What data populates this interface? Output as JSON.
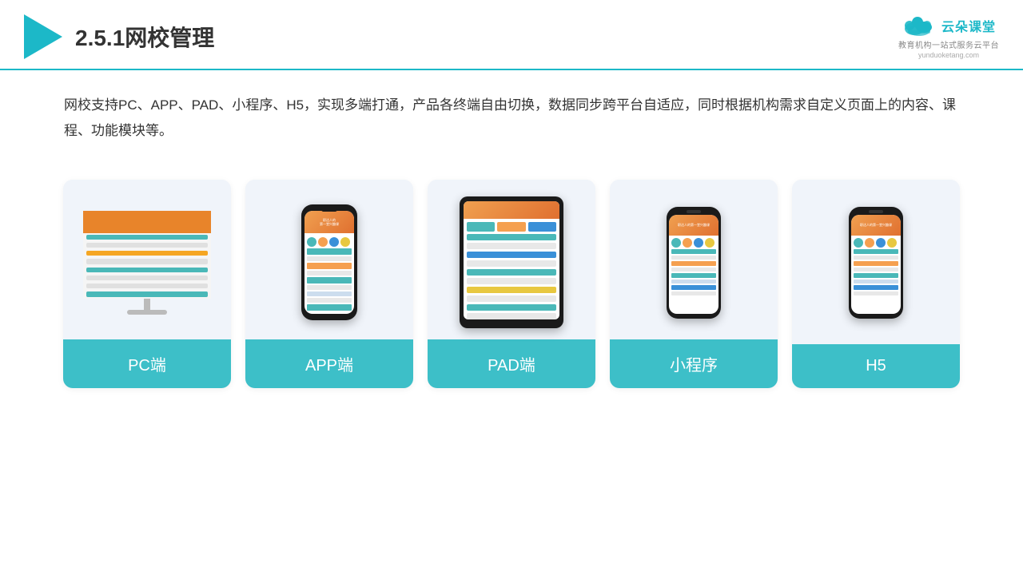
{
  "header": {
    "title": "2.5.1网校管理",
    "logo_name": "云朵课堂",
    "logo_url": "yunduoketang.com",
    "logo_tagline": "教育机构一站式服务云平台"
  },
  "description": "网校支持PC、APP、PAD、小程序、H5，实现多端打通，产品各终端自由切换，数据同步跨平台自适应，同时根据机构需求自定义页面上的内容、课程、功能模块等。",
  "cards": [
    {
      "id": "pc",
      "label": "PC端"
    },
    {
      "id": "app",
      "label": "APP端"
    },
    {
      "id": "pad",
      "label": "PAD端"
    },
    {
      "id": "miniprogram",
      "label": "小程序"
    },
    {
      "id": "h5",
      "label": "H5"
    }
  ],
  "colors": {
    "accent": "#1cb8c8",
    "card_bg": "#f0f4fa",
    "card_label_bg": "#3dbfc8"
  }
}
